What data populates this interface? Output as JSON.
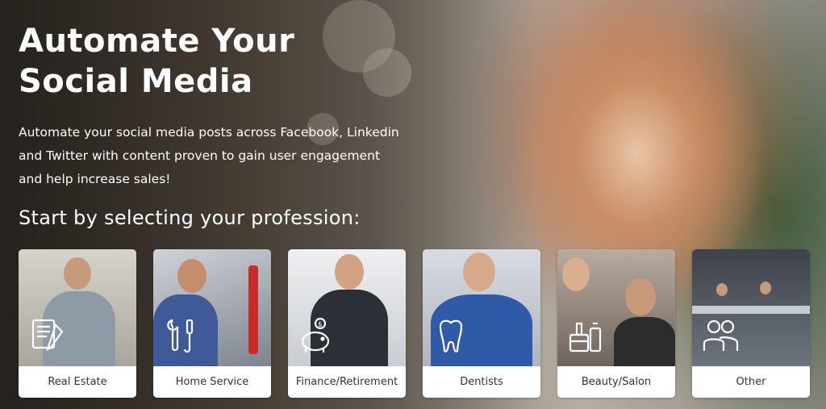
{
  "hero": {
    "headline_line1": "Automate Your",
    "headline_line2": "Social Media",
    "intro_line1": "Automate your social media posts across Facebook, Linkedin",
    "intro_line2": "and Twitter with content proven to gain user engagement",
    "intro_line3": "and help increase sales!",
    "prompt": "Start by selecting your profession:"
  },
  "professions": [
    {
      "label": "Real Estate",
      "icon": "document-icon",
      "bg": "#b9b7b0"
    },
    {
      "label": "Home Service",
      "icon": "tools-icon",
      "bg": "#8a8f99"
    },
    {
      "label": "Finance/Retirement",
      "icon": "piggy-bank-icon",
      "bg": "#d6d9dd"
    },
    {
      "label": "Dentists",
      "icon": "tooth-icon",
      "bg": "#c9ced6"
    },
    {
      "label": "Beauty/Salon",
      "icon": "salon-products-icon",
      "bg": "#9c8f86"
    },
    {
      "label": "Other",
      "icon": "people-icon",
      "bg": "#5b6068"
    }
  ]
}
